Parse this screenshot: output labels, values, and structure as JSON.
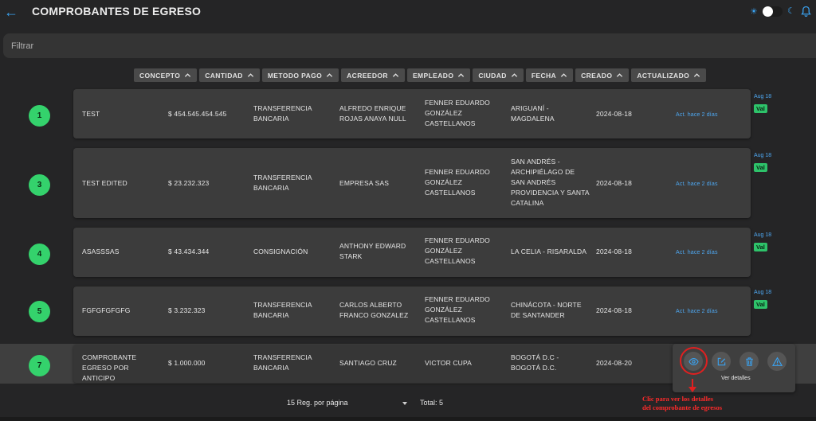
{
  "header": {
    "title": "COMPROBANTES DE EGRESO"
  },
  "filter": {
    "placeholder": "Filtrar"
  },
  "columns": [
    "CONCEPTO",
    "CANTIDAD",
    "METODO PAGO",
    "ACREEDOR",
    "EMPLEADO",
    "CIUDAD",
    "FECHA",
    "CREADO",
    "ACTUALIZADO"
  ],
  "rows": [
    {
      "id": "1",
      "concepto": "TEST",
      "cantidad": "$ 454.545.454.545",
      "metodo": "TRANSFERENCIA BANCARIA",
      "acreedor": "ALFREDO ENRIQUE ROJAS ANAYA NULL",
      "empleado": "FENNER EDUARDO GONZÁLEZ CASTELLANOS",
      "ciudad": "ARIGUANÍ - MAGDALENA",
      "fecha": "2024-08-18",
      "actualizado": "Act. hace 2 días",
      "side_date": "Aug 18",
      "side_badge": "Val"
    },
    {
      "id": "3",
      "concepto": "TEST EDITED",
      "cantidad": "$ 23.232.323",
      "metodo": "TRANSFERENCIA BANCARIA",
      "acreedor": "EMPRESA SAS",
      "empleado": "FENNER EDUARDO GONZÁLEZ CASTELLANOS",
      "ciudad": "SAN ANDRÉS - ARCHIPIÉLAGO DE SAN ANDRÉS PROVIDENCIA Y SANTA CATALINA",
      "fecha": "2024-08-18",
      "actualizado": "Act. hace 2 días",
      "side_date": "Aug 18",
      "side_badge": "Val"
    },
    {
      "id": "4",
      "concepto": "ASASSSAS",
      "cantidad": "$ 43.434.344",
      "metodo": "CONSIGNACIÓN",
      "acreedor": "ANTHONY EDWARD STARK",
      "empleado": "FENNER EDUARDO GONZÁLEZ CASTELLANOS",
      "ciudad": "LA CELIA - RISARALDA",
      "fecha": "2024-08-18",
      "actualizado": "Act. hace 2 días",
      "side_date": "Aug 18",
      "side_badge": "Val"
    },
    {
      "id": "5",
      "concepto": "FGFGFGFGFG",
      "cantidad": "$ 3.232.323",
      "metodo": "TRANSFERENCIA BANCARIA",
      "acreedor": "CARLOS ALBERTO FRANCO GONZALEZ",
      "empleado": "FENNER EDUARDO GONZÁLEZ CASTELLANOS",
      "ciudad": "CHINÁCOTA - NORTE DE SANTANDER",
      "fecha": "2024-08-18",
      "actualizado": "Act. hace 2 días",
      "side_date": "Aug 18",
      "side_badge": "Val"
    },
    {
      "id": "7",
      "concepto": "COMPROBANTE EGRESO POR ANTICIPO",
      "cantidad": "$ 1.000.000",
      "metodo": "TRANSFERENCIA BANCARIA",
      "acreedor": "SANTIAGO CRUZ",
      "empleado": "VICTOR CUPA",
      "ciudad": "BOGOTÁ D.C - BOGOTÁ D.C.",
      "fecha": "2024-08-20",
      "actualizado": "A"
    }
  ],
  "actions": {
    "tooltip": "Ver detalles"
  },
  "annotation": {
    "line1": "Clic para ver los detalles",
    "line2": "del comprobante  de egresos"
  },
  "footer": {
    "per_page": "15 Reg. por página",
    "total": "Total: 5"
  },
  "colors": {
    "accent": "#3aa2f0",
    "badge_green": "#34d26c",
    "annotation_red": "#e02020"
  }
}
